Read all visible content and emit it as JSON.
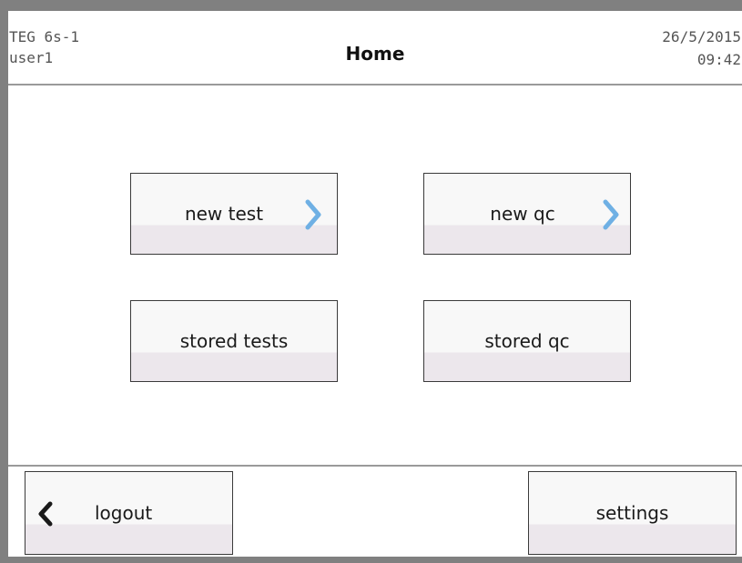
{
  "header": {
    "device_name": "TEG 6s-1",
    "user_name": "user1",
    "title": "Home",
    "date": "26/5/2015",
    "time": "09:42"
  },
  "main": {
    "new_test_label": "new test",
    "new_qc_label": "new qc",
    "stored_tests_label": "stored tests",
    "stored_qc_label": "stored qc"
  },
  "footer": {
    "logout_label": "logout",
    "settings_label": "settings"
  },
  "icons": {
    "forward": "chevron-right-icon",
    "back": "chevron-left-icon"
  },
  "colors": {
    "accent_arrow": "#6fb0e4",
    "back_arrow": "#1a1a1a",
    "button_bottom": "#ece7ec",
    "bezel": "#808080"
  }
}
